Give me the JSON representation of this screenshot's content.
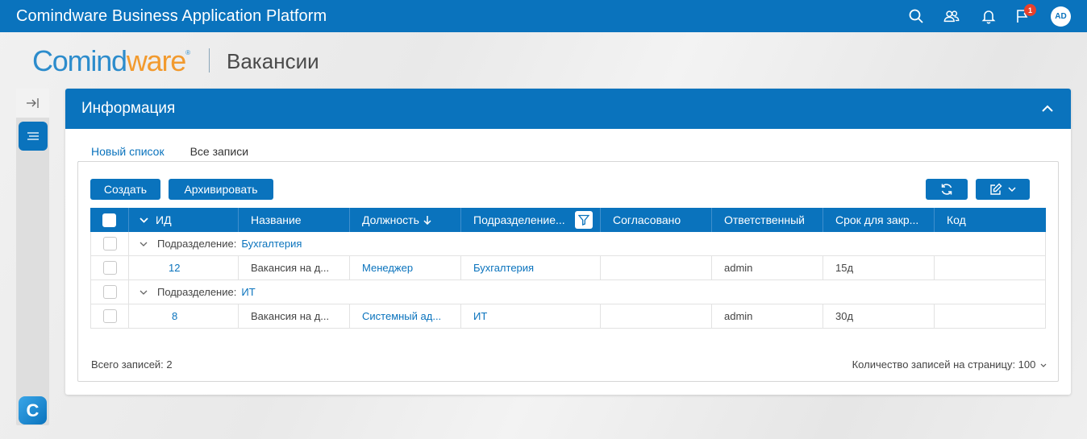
{
  "topbar": {
    "app_title": "Comindware Business Application Platform",
    "notification_count": "1",
    "avatar_initials": "AD",
    "icons": [
      "search-icon",
      "users-icon",
      "bell-icon",
      "flag-icon"
    ],
    "background": "#0a73bd"
  },
  "header": {
    "logo_part1": "Comind",
    "logo_part2": "ware",
    "logo_reg": "®",
    "page_title": "Вакансии"
  },
  "sidebar": {
    "logo_letter": "C",
    "icons": [
      "collapse-arrow-icon",
      "menu-lines-icon"
    ]
  },
  "panel": {
    "title": "Информация",
    "tabs": [
      {
        "label": "Новый список",
        "active": true
      },
      {
        "label": "Все записи",
        "active": false
      }
    ],
    "toolbar": {
      "create_label": "Создать",
      "archive_label": "Архивировать"
    },
    "table": {
      "columns": [
        "ИД",
        "Название",
        "Должность",
        "Подразделение...",
        "Согласовано",
        "Ответственный",
        "Срок для закр...",
        "Код"
      ],
      "groups": [
        {
          "label": "Подразделение:",
          "value": "Бухгалтерия",
          "rows": [
            {
              "id": "12",
              "name": "Вакансия на д...",
              "position": "Менеджер",
              "department": "Бухгалтерия",
              "approved": "",
              "responsible": "admin",
              "deadline": "15д",
              "code": ""
            }
          ]
        },
        {
          "label": "Подразделение:",
          "value": "ИТ",
          "rows": [
            {
              "id": "8",
              "name": "Вакансия на д...",
              "position": "Системный ад...",
              "department": "ИТ",
              "approved": "",
              "responsible": "admin",
              "deadline": "30д",
              "code": ""
            }
          ]
        }
      ]
    },
    "footer": {
      "total_label": "Всего записей: 2",
      "page_size_label": "Количество записей на страницу: 100"
    }
  }
}
